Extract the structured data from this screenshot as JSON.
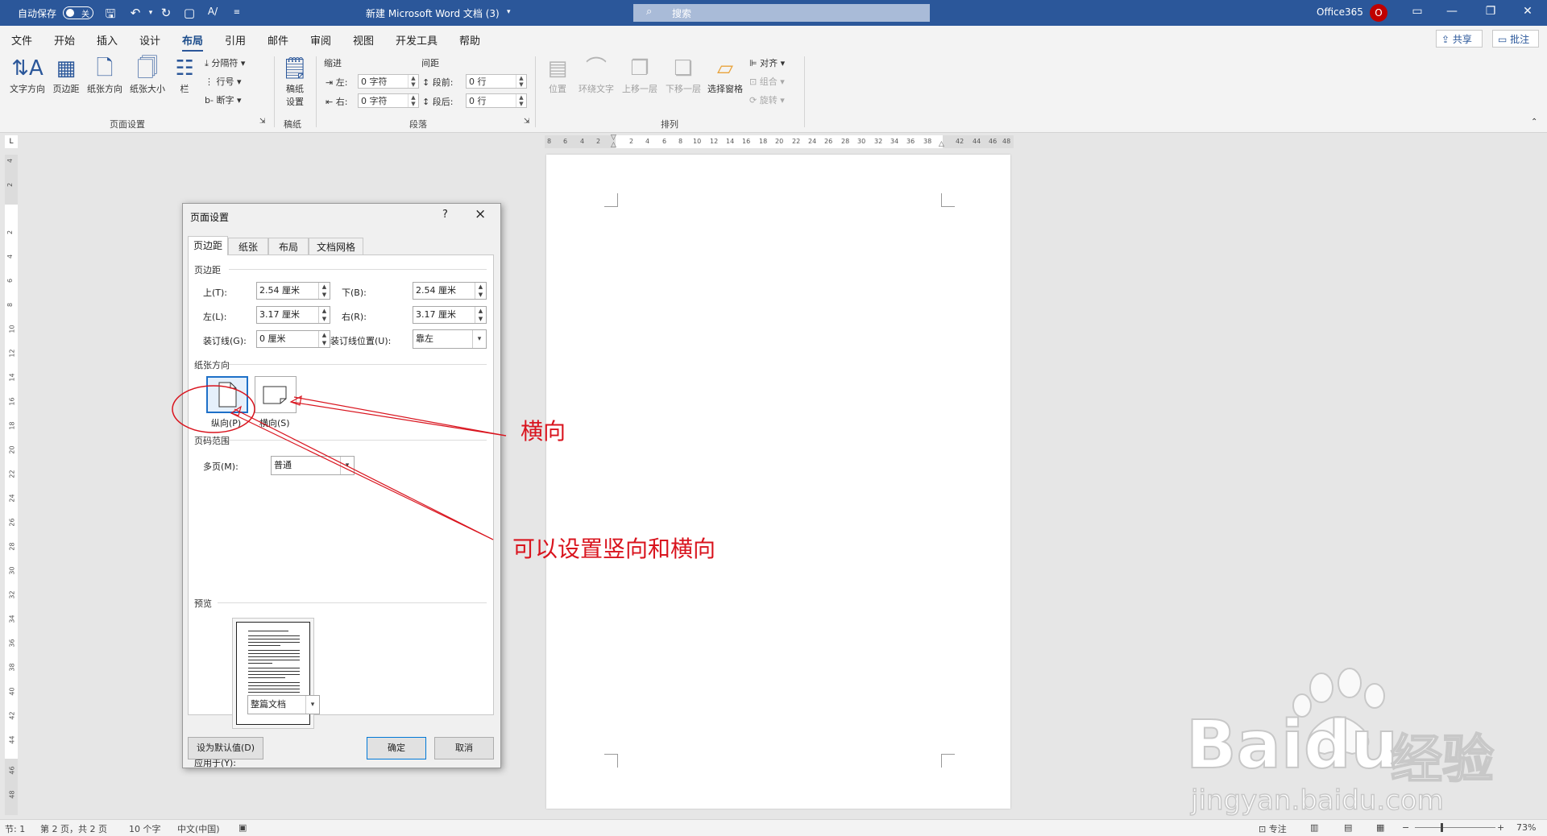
{
  "titlebar": {
    "autosave_label": "自动保存",
    "autosave_state": "关",
    "doc_title": "新建 Microsoft Word 文档 (3)",
    "search_placeholder": "搜索",
    "account": "Office365",
    "avatar_letter": "O"
  },
  "menu": {
    "tabs": [
      "文件",
      "开始",
      "插入",
      "设计",
      "布局",
      "引用",
      "邮件",
      "审阅",
      "视图",
      "开发工具",
      "帮助"
    ],
    "active": "布局",
    "share_label": "共享",
    "comment_label": "批注"
  },
  "ribbon": {
    "page_setup": {
      "buttons": [
        "文字方向",
        "页边距",
        "纸张方向",
        "纸张大小",
        "栏"
      ],
      "small": [
        "分隔符",
        "行号",
        "断字"
      ],
      "label": "页面设置"
    },
    "draft": {
      "button": [
        "稿纸",
        "设置"
      ],
      "label": "稿纸"
    },
    "paragraph": {
      "indent_title": "缩进",
      "spacing_title": "间距",
      "left_label": "左:",
      "right_label": "右:",
      "before_label": "段前:",
      "after_label": "段后:",
      "left_value": "0 字符",
      "right_value": "0 字符",
      "before_value": "0 行",
      "after_value": "0 行",
      "label": "段落"
    },
    "arrange": {
      "buttons": [
        "位置",
        "环绕文字",
        "上移一层",
        "下移一层",
        "选择窗格"
      ],
      "small": [
        "对齐",
        "组合",
        "旋转"
      ],
      "label": "排列"
    }
  },
  "ruler": {
    "h_labels": [
      "8",
      "6",
      "4",
      "2",
      "2",
      "4",
      "6",
      "8",
      "10",
      "12",
      "14",
      "16",
      "18",
      "20",
      "22",
      "24",
      "26",
      "28",
      "30",
      "32",
      "34",
      "36",
      "38",
      "42",
      "44",
      "46",
      "48"
    ],
    "v_labels": [
      "4",
      "2",
      "2",
      "4",
      "6",
      "8",
      "10",
      "12",
      "14",
      "16",
      "18",
      "20",
      "22",
      "24",
      "26",
      "28",
      "30",
      "32",
      "34",
      "36",
      "38",
      "40",
      "42",
      "44",
      "46",
      "48"
    ]
  },
  "dialog": {
    "title": "页面设置",
    "help": "?",
    "close": "×",
    "tabs": [
      "页边距",
      "纸张",
      "布局",
      "文档网格"
    ],
    "active_tab": "页边距",
    "margins_section": "页边距",
    "top_label": "上(T):",
    "top_value": "2.54 厘米",
    "bottom_label": "下(B):",
    "bottom_value": "2.54 厘米",
    "left_label": "左(L):",
    "left_value": "3.17 厘米",
    "right_label": "右(R):",
    "right_value": "3.17 厘米",
    "gutter_label": "装订线(G):",
    "gutter_value": "0 厘米",
    "gutter_pos_label": "装订线位置(U):",
    "gutter_pos_value": "靠左",
    "orientation_section": "纸张方向",
    "portrait_label": "纵向(P)",
    "landscape_label": "横向(S)",
    "pages_section": "页码范围",
    "multi_label": "多页(M):",
    "multi_value": "普通",
    "preview_section": "预览",
    "apply_label": "应用于(Y):",
    "apply_value": "整篇文档",
    "default_button": "设为默认值(D)",
    "ok_button": "确定",
    "cancel_button": "取消"
  },
  "annotations": {
    "landscape_note": "横向",
    "orientation_note": "可以设置竖向和横向",
    "color": "#d9141e"
  },
  "statusbar": {
    "section": "节: 1",
    "page": "第 2 页，共 2 页",
    "words": "10 个字",
    "language": "中文(中国)",
    "focus": "专注",
    "zoom": "73%"
  },
  "watermark": {
    "brand": "Baidu",
    "brand_cn": "经验",
    "url": "jingyan.baidu.com"
  }
}
